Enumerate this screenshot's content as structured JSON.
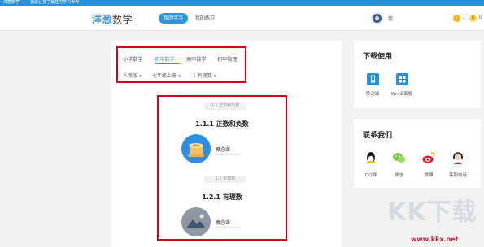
{
  "window": {
    "title": "洋葱数学 —— 创建让孩子最佳的学习世界"
  },
  "header": {
    "logo_main": "洋葱",
    "logo_sub": "数学",
    "nav": [
      {
        "label": "我的学习",
        "active": true
      },
      {
        "label": "我的练习",
        "active": false
      }
    ],
    "user": {
      "name": "苑"
    },
    "counters": [
      {
        "icon": "bolt-icon",
        "value": "1"
      },
      {
        "icon": "coin-icon",
        "value": "0"
      }
    ]
  },
  "course": {
    "tabs": [
      {
        "label": "小学数学",
        "active": false
      },
      {
        "label": "初中数学",
        "active": true
      },
      {
        "label": "高中数学",
        "active": false
      },
      {
        "label": "初中物理",
        "active": false
      }
    ],
    "filters": [
      {
        "label": "人教版"
      },
      {
        "label": "七年级上册"
      },
      {
        "label": "1 有理数"
      }
    ]
  },
  "chapters": [
    {
      "chip": "1.1 正数和负数",
      "title": "1.1.1 正数和负数",
      "lesson": "概念课"
    },
    {
      "chip": "1.2 有理数",
      "title": "1.2.1 有理数",
      "lesson": "概念课"
    }
  ],
  "download": {
    "title": "下载使用",
    "items": [
      {
        "label": "移动端",
        "icon": "mobile-icon"
      },
      {
        "label": "Win桌面版",
        "icon": "windows-icon"
      }
    ]
  },
  "contact": {
    "title": "联系我们",
    "items": [
      {
        "label": "QQ群",
        "icon": "qq-icon"
      },
      {
        "label": "微信",
        "icon": "wechat-icon"
      },
      {
        "label": "微博",
        "icon": "weibo-icon"
      },
      {
        "label": "客服电话",
        "icon": "headset-icon"
      }
    ]
  },
  "watermark": {
    "text": "KK下载",
    "url": "www.kkx.net"
  },
  "colors": {
    "accent": "#2b95e0",
    "highlight_border": "#d0021b"
  }
}
